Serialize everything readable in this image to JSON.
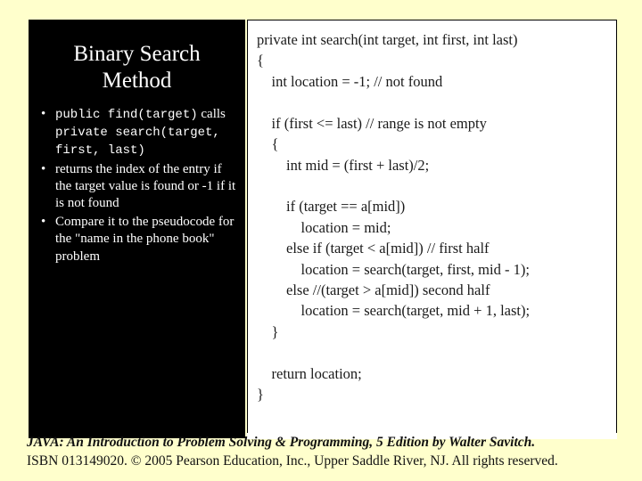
{
  "slide": {
    "title": "Binary Search Method",
    "bullets": [
      {
        "marker": "•",
        "segments": [
          {
            "text": "public find(target)",
            "style": "mono"
          },
          {
            "text": " calls ",
            "style": "serif"
          },
          {
            "text": "private search(target, first, last)",
            "style": "mono"
          }
        ],
        "plain": "public find(target) calls private search(target, first, last)"
      },
      {
        "marker": "•",
        "segments": [
          {
            "text": "returns the index of the entry if the target value is found or -1 if it is not found",
            "style": "serif"
          }
        ],
        "plain": "returns the index of the entry if the target value is found or -1 if it is not found"
      },
      {
        "marker": "•",
        "segments": [
          {
            "text": "Compare it to the pseudocode for the \"name in the phone book\" problem",
            "style": "serif"
          }
        ],
        "plain": "Compare it to the pseudocode for the \"name in the phone book\" problem"
      }
    ],
    "code": "private int search(int target, int first, int last)\n{\n    int location = -1; // not found\n\n    if (first <= last) // range is not empty\n    {\n        int mid = (first + last)/2;\n\n        if (target == a[mid])\n            location = mid;\n        else if (target < a[mid]) // first half\n            location = search(target, first, mid - 1);\n        else //(target > a[mid]) second half\n            location = search(target, mid + 1, last);\n    }\n\n    return location;\n}",
    "footer_line1": "JAVA: An Introduction to Problem Solving & Programming, 5 Edition by Walter Savitch.",
    "footer_line2": "ISBN 013149020. © 2005 Pearson Education, Inc., Upper Saddle River, NJ. All rights reserved."
  },
  "colors": {
    "background": "#ffffcc",
    "panel": "#000000",
    "panel_text": "#ffffff",
    "code_bg": "#ffffff",
    "code_text": "#1a1a1a"
  }
}
